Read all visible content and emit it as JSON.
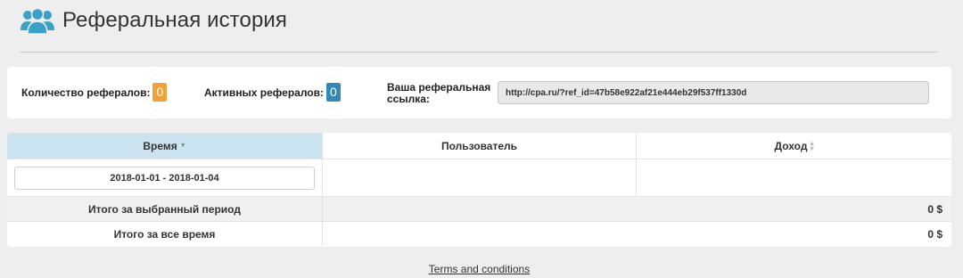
{
  "header": {
    "title": "Реферальная история",
    "icon": "users-icon",
    "icon_color": "#3ba0c9"
  },
  "stats": {
    "referrals_label": "Количество рефералов:",
    "referrals_count": "0",
    "active_label": "Активных рефералов:",
    "active_count": "0",
    "link_label": "Ваша реферальная ссылка:",
    "link_value": "http://cpa.ru/?ref_id=47b58e922af21e444eb29f537ff1330d"
  },
  "table": {
    "columns": [
      "Время",
      "Пользователь",
      "Доход"
    ],
    "date_range": "2018-01-01 - 2018-01-04",
    "total_period_label": "Итого за выбранный период",
    "total_period_value": "0 $",
    "total_all_label": "Итого за все время",
    "total_all_value": "0 $"
  },
  "colors": {
    "badge_orange": "#f0a23a",
    "badge_blue": "#3489b4",
    "sorted_header_bg": "#cce3f2"
  },
  "footer": {
    "terms_link": "Terms and conditions"
  }
}
